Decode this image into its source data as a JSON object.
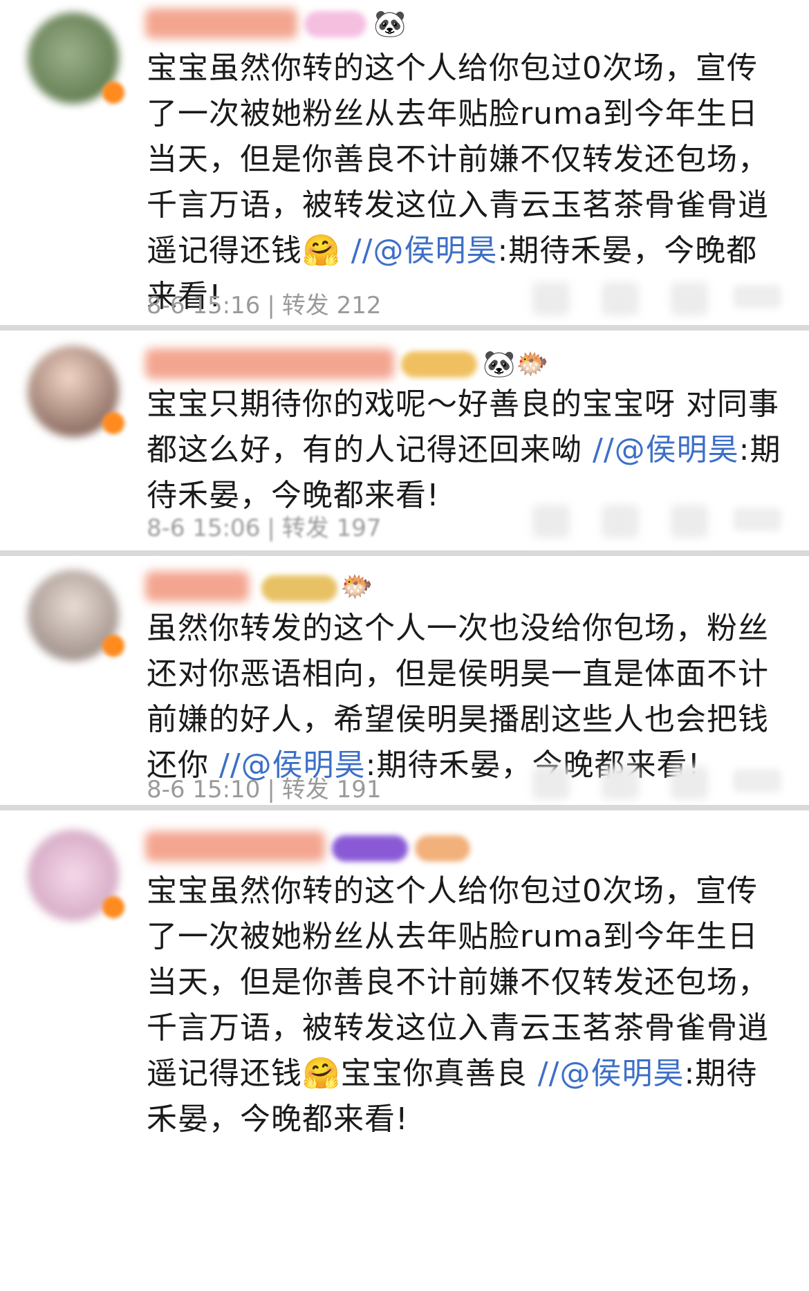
{
  "comments": [
    {
      "text_before": "宝宝虽然你转的这个人给你包过0次场，宣传了一次被她粉丝从去年贴脸ruma到今年生日当天，但是你善良不计前嫌不仅转发还包场，千言万语，被转发这位入青云玉茗茶骨雀骨逍遥记得还钱",
      "emoji_mid": "🤗",
      "text_mid": "",
      "mention": "//@侯明昊",
      "text_after": ":期待禾晏，今晚都来看!",
      "time": "8-6 15:16",
      "repost_label": "转发",
      "repost_count": "212",
      "badge_emojis": [
        "🐼"
      ]
    },
    {
      "text_before": "宝宝只期待你的戏呢～好善良的宝宝呀 对同事都这么好，有的人记得还回来呦",
      "emoji_mid": "",
      "text_mid": "",
      "mention": "//@侯明昊",
      "text_after": ":期待禾晏，今晚都来看!",
      "time": "8-6 15:06",
      "repost_label": "转发",
      "repost_count": "197",
      "badge_emojis": [
        "🐼",
        "🐡"
      ]
    },
    {
      "text_before": "虽然你转发的这个人一次也没给你包场，粉丝还对你恶语相向，但是侯明昊一直是体面不计前嫌的好人，希望侯明昊播剧这些人也会把钱还你",
      "emoji_mid": "",
      "text_mid": "",
      "mention": "//@侯明昊",
      "text_after": ":期待禾晏，今晚都来看!",
      "time": "8-6 15:10",
      "repost_label": "转发",
      "repost_count": "191",
      "badge_emojis": [
        "🐡"
      ]
    },
    {
      "text_before": "宝宝虽然你转的这个人给你包过0次场，宣传了一次被她粉丝从去年贴脸ruma到今年生日当天，但是你善良不计前嫌不仅转发还包场，千言万语，被转发这位入青云玉茗茶骨雀骨逍遥记得还钱",
      "emoji_mid": "🤗",
      "text_mid": "宝宝你真善良",
      "mention": "//@侯明昊",
      "text_after": ":期待禾晏，今晚都来看!",
      "time": "",
      "repost_label": "",
      "repost_count": "",
      "badge_emojis": []
    }
  ],
  "colors": {
    "mention": "#3d6fc7",
    "text": "#1a1a1a",
    "meta": "#9a9a9a",
    "background": "#d9d9d9"
  }
}
